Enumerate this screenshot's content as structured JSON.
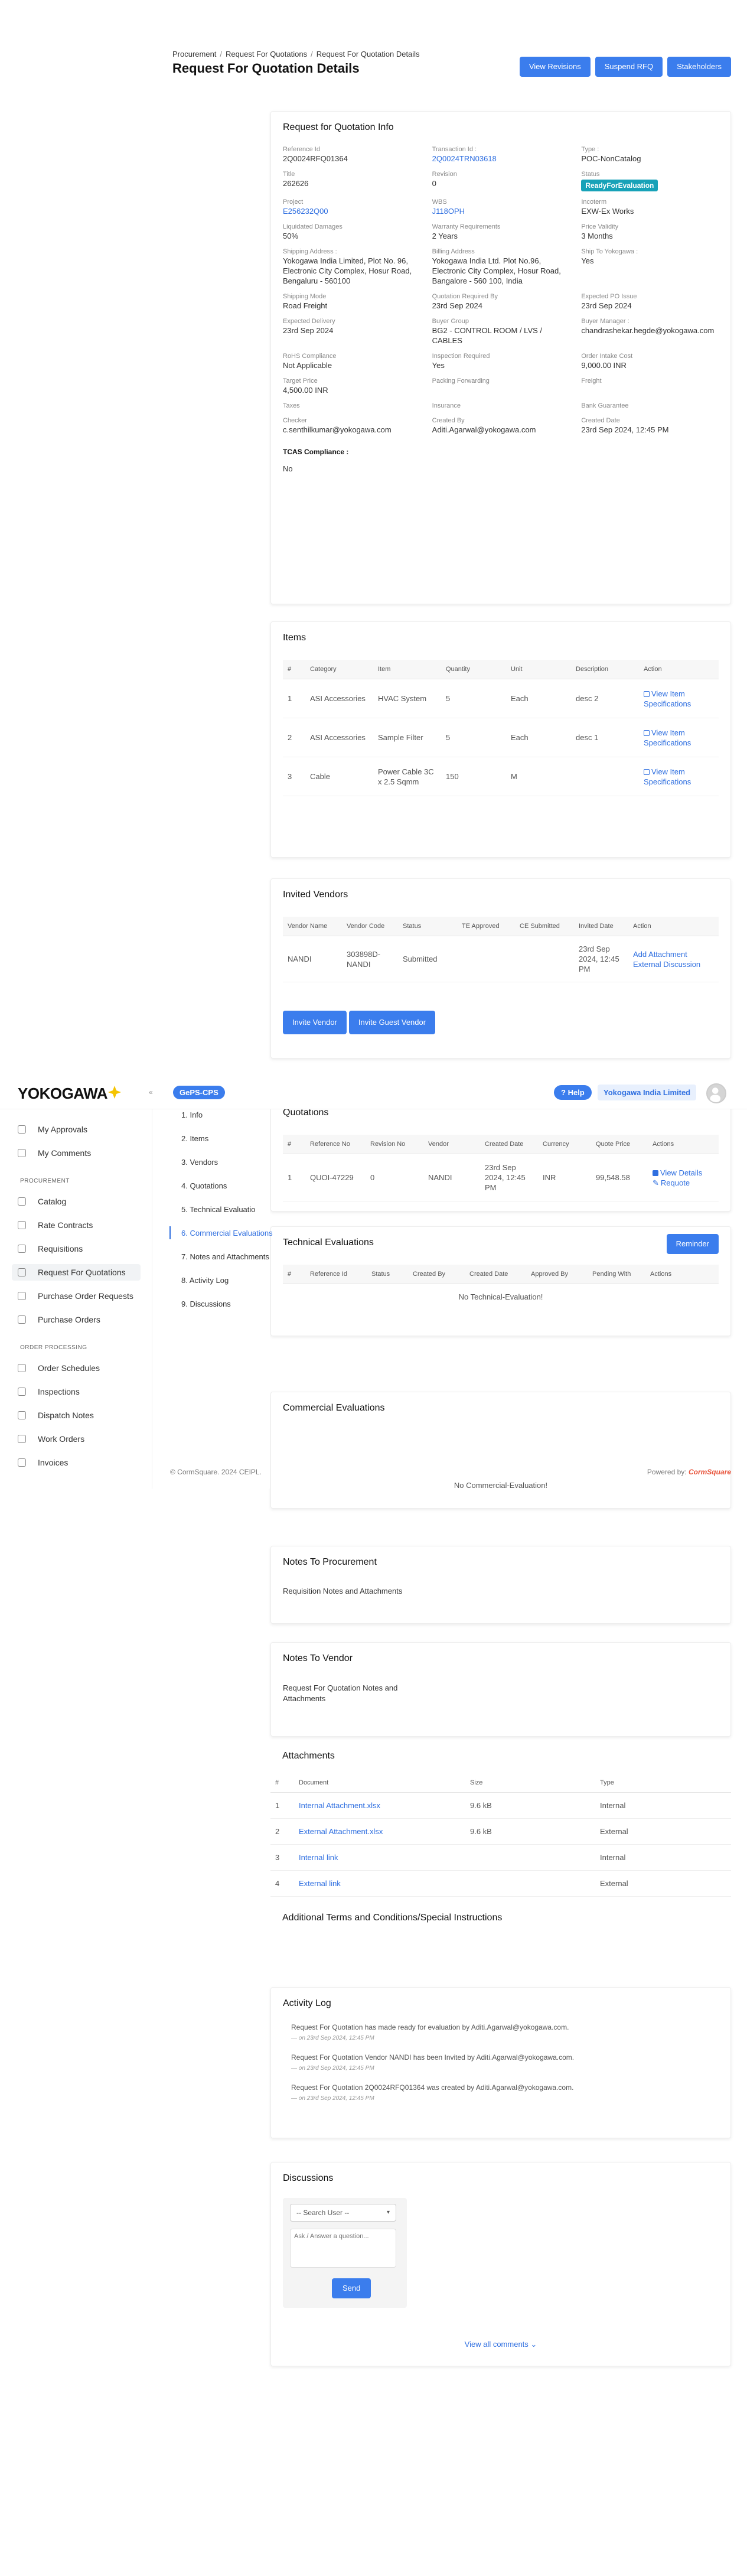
{
  "header": {
    "breadcrumb": [
      "Procurement",
      "Request For Quotations",
      "Request For Quotation Details"
    ],
    "title": "Request For Quotation Details",
    "buttons": {
      "revisions": "View Revisions",
      "suspend": "Suspend RFQ",
      "stakeholders": "Stakeholders"
    }
  },
  "info": {
    "title": "Request for Quotation Info",
    "fields": [
      {
        "label": "Reference Id",
        "value": "2Q0024RFQ01364"
      },
      {
        "label": "Transaction Id :",
        "value": "2Q0024TRN03618",
        "link": true
      },
      {
        "label": "Type :",
        "value": "POC-NonCatalog"
      },
      {
        "label": "Title",
        "value": "262626"
      },
      {
        "label": "Revision",
        "value": "0"
      },
      {
        "label": "Status",
        "value": "ReadyForEvaluation",
        "badge": true
      },
      {
        "label": "Project",
        "value": "E256232Q00",
        "link": true
      },
      {
        "label": "WBS",
        "value": "J118OPH",
        "link": true
      },
      {
        "label": "Incoterm",
        "value": "EXW-Ex Works"
      },
      {
        "label": "Liquidated Damages",
        "value": "50%"
      },
      {
        "label": "Warranty Requirements",
        "value": "2 Years"
      },
      {
        "label": "Price Validity",
        "value": "3 Months"
      },
      {
        "label": "Shipping Address :",
        "value": "Yokogawa India Limited, Plot No. 96, Electronic City Complex, Hosur Road, Bengaluru - 560100"
      },
      {
        "label": "Billing Address",
        "value": "Yokogawa India Ltd. Plot No.96, Electronic City Complex, Hosur Road, Bangalore - 560 100, India"
      },
      {
        "label": "Ship To Yokogawa :",
        "value": "Yes"
      },
      {
        "label": "Shipping Mode",
        "value": "Road Freight"
      },
      {
        "label": "Quotation Required By",
        "value": "23rd Sep 2024"
      },
      {
        "label": "Expected PO Issue",
        "value": "23rd Sep 2024"
      },
      {
        "label": "Expected Delivery",
        "value": "23rd Sep 2024"
      },
      {
        "label": "Buyer Group",
        "value": "BG2 - CONTROL ROOM / LVS / CABLES"
      },
      {
        "label": "Buyer Manager :",
        "value": "chandrashekar.hegde@yokogawa.com"
      },
      {
        "label": "RoHS Compliance",
        "value": "Not Applicable"
      },
      {
        "label": "Inspection Required",
        "value": "Yes"
      },
      {
        "label": "Order Intake Cost",
        "value": "9,000.00 INR"
      },
      {
        "label": "Target Price",
        "value": "4,500.00 INR"
      },
      {
        "label": "Packing Forwarding",
        "value": ""
      },
      {
        "label": "Freight",
        "value": ""
      },
      {
        "label": "Taxes",
        "value": ""
      },
      {
        "label": "Insurance",
        "value": ""
      },
      {
        "label": "Bank Guarantee",
        "value": ""
      },
      {
        "label": "Checker",
        "value": "c.senthilkumar@yokogawa.com"
      },
      {
        "label": "Created By",
        "value": "Aditi.Agarwal@yokogawa.com"
      },
      {
        "label": "Created Date",
        "value": "23rd Sep 2024, 12:45 PM"
      }
    ],
    "tcas_label": "TCAS Compliance :",
    "tcas_value": "No"
  },
  "items": {
    "title": "Items",
    "columns": [
      "#",
      "Category",
      "Item",
      "Quantity",
      "Unit",
      "Description",
      "Action"
    ],
    "rows": [
      {
        "n": "1",
        "category": "ASI Accessories",
        "item": "HVAC System",
        "qty": "5",
        "unit": "Each",
        "desc": "desc 2",
        "action": "View Item Specifications"
      },
      {
        "n": "2",
        "category": "ASI Accessories",
        "item": "Sample Filter",
        "qty": "5",
        "unit": "Each",
        "desc": "desc 1",
        "action": "View Item Specifications"
      },
      {
        "n": "3",
        "category": "Cable",
        "item": "Power Cable 3C x 2.5 Sqmm",
        "qty": "150",
        "unit": "M",
        "desc": "",
        "action": "View Item Specifications"
      }
    ]
  },
  "vendors": {
    "title": "Invited Vendors",
    "columns": [
      "Vendor Name",
      "Vendor Code",
      "Status",
      "TE Approved",
      "CE Submitted",
      "Invited Date",
      "Action"
    ],
    "row": {
      "name": "NANDI",
      "code": "303898D-NANDI",
      "status": "Submitted",
      "te": "",
      "ce": "",
      "date": "23rd Sep 2024, 12:45 PM",
      "action1": "Add Attachment",
      "action2": "External Discussion"
    },
    "btn_invite": "Invite Vendor",
    "btn_guest": "Invite Guest Vendor"
  },
  "app": {
    "logo": "YOKOGAWA",
    "module": "GePS-CPS",
    "help": "Help",
    "org": "Yokogawa India Limited"
  },
  "sidebar": {
    "top": [
      "My Approvals",
      "My Comments"
    ],
    "procurement_label": "PROCUREMENT",
    "procurement": [
      "Catalog",
      "Rate Contracts",
      "Requisitions",
      "Request For Quotations",
      "Purchase Order Requests",
      "Purchase Orders"
    ],
    "order_label": "ORDER PROCESSING",
    "order": [
      "Order Schedules",
      "Inspections",
      "Dispatch Notes",
      "Work Orders",
      "Invoices"
    ]
  },
  "subnav": [
    "1. Info",
    "2. Items",
    "3. Vendors",
    "4. Quotations",
    "5. Technical Evaluatio",
    "6. Commercial Evaluations",
    "7. Notes and Attachments",
    "8. Activity Log",
    "9. Discussions"
  ],
  "quotations": {
    "title": "Quotations",
    "columns": [
      "#",
      "Reference No",
      "Revision No",
      "Vendor",
      "Created Date",
      "Currency",
      "Quote Price",
      "Actions"
    ],
    "row": {
      "n": "1",
      "ref": "QUOI-47229",
      "rev": "0",
      "vendor": "NANDI",
      "date": "23rd Sep 2024, 12:45 PM",
      "currency": "INR",
      "price": "99,548.58",
      "act1": "View Details",
      "act2": "Requote"
    }
  },
  "technical": {
    "title": "Technical Evaluations",
    "reminder": "Reminder",
    "columns": [
      "#",
      "Reference Id",
      "Status",
      "Created By",
      "Created Date",
      "Approved By",
      "Pending With",
      "Actions"
    ],
    "empty": "No Technical-Evaluation!"
  },
  "commercial": {
    "title": "Commercial Evaluations",
    "empty": "No Commercial-Evaluation!"
  },
  "footer": {
    "copyright": "© CormSquare. 2024 CEIPL.",
    "powered": "Powered by:",
    "brand": "CormSquare"
  },
  "notes_proc": {
    "title": "Notes To Procurement",
    "text": "Requisition Notes and Attachments"
  },
  "notes_vendor": {
    "title": "Notes To Vendor",
    "text": "Request For Quotation Notes and Attachments"
  },
  "attachments": {
    "title": "Attachments",
    "columns": [
      "#",
      "Document",
      "Size",
      "Type"
    ],
    "rows": [
      {
        "n": "1",
        "doc": "Internal Attachment.xlsx",
        "size": "9.6 kB",
        "type": "Internal"
      },
      {
        "n": "2",
        "doc": "External Attachment.xlsx",
        "size": "9.6 kB",
        "type": "External"
      },
      {
        "n": "3",
        "doc": "Internal link",
        "size": "",
        "type": "Internal"
      },
      {
        "n": "4",
        "doc": "External link",
        "size": "",
        "type": "External"
      }
    ]
  },
  "terms": {
    "title": "Additional Terms and Conditions/Special Instructions"
  },
  "activity": {
    "title": "Activity Log",
    "entries": [
      {
        "text": "Request For Quotation has made ready for evaluation by Aditi.Agarwal@yokogawa.com.",
        "time": "— on 23rd Sep 2024, 12:45 PM"
      },
      {
        "text": "Request For Quotation Vendor NANDI has been Invited by Aditi.Agarwal@yokogawa.com.",
        "time": "— on 23rd Sep 2024, 12:45 PM"
      },
      {
        "text": "Request For Quotation 2Q0024RFQ01364 was created by Aditi.Agarwal@yokogawa.com.",
        "time": "— on 23rd Sep 2024, 12:45 PM"
      }
    ]
  },
  "discussions": {
    "title": "Discussions",
    "search_placeholder": "-- Search User --",
    "textarea_placeholder": "Ask / Answer a question...",
    "send": "Send",
    "view_all": "View all comments"
  }
}
